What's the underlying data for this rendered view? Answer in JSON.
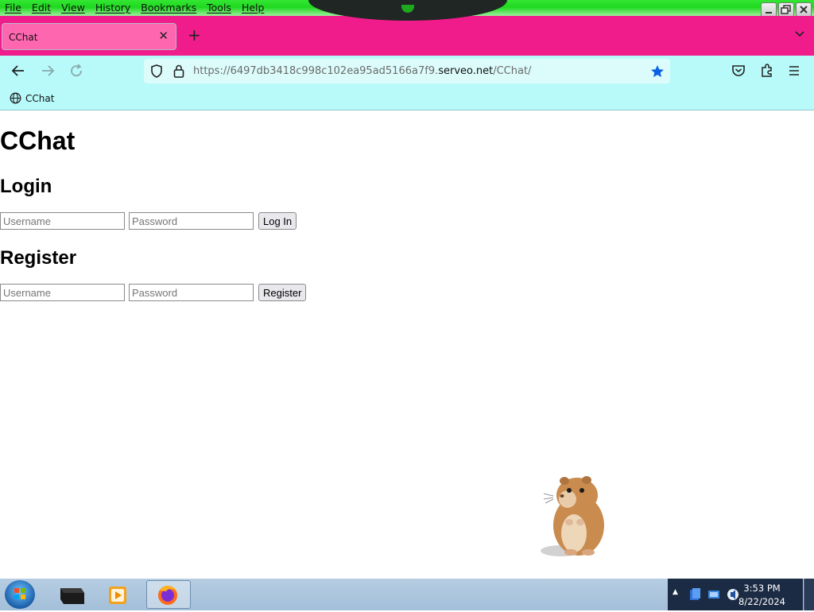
{
  "menu": [
    "File",
    "Edit",
    "View",
    "History",
    "Bookmarks",
    "Tools",
    "Help"
  ],
  "tab": {
    "title": "CChat"
  },
  "address": {
    "prefix": "https://6497db3418c998c102ea95ad5166a7f9.",
    "domain": "serveo.net",
    "path": "/CChat/"
  },
  "bookmarks": [
    {
      "label": "CChat"
    }
  ],
  "page": {
    "title": "CChat",
    "login": {
      "heading": "Login",
      "username_placeholder": "Username",
      "password_placeholder": "Password",
      "button": "Log In"
    },
    "register": {
      "heading": "Register",
      "username_placeholder": "Username",
      "password_placeholder": "Password",
      "button": "Register"
    }
  },
  "taskbar": {
    "time": "3:53 PM",
    "date": "8/22/2024"
  },
  "colors": {
    "menubar": "#1fd91f",
    "tabstrip": "#f01c8c",
    "navbar": "#b8fafa",
    "bookmark_star": "#0a60e6"
  }
}
